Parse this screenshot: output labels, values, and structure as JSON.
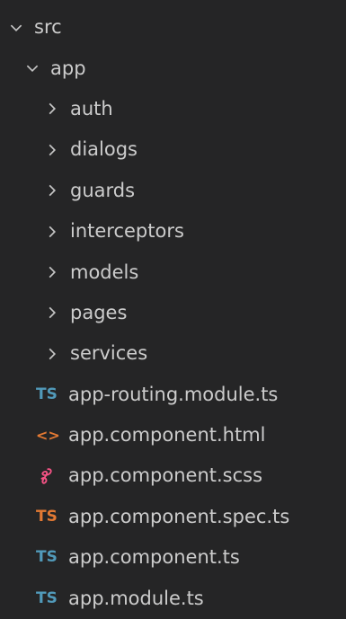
{
  "explorer": {
    "root": {
      "label": "src",
      "expanded": true,
      "icon": "chevron-down-icon"
    },
    "app": {
      "label": "app",
      "expanded": true,
      "icon": "chevron-down-icon"
    },
    "folders": [
      {
        "label": "auth",
        "icon": "chevron-right-icon"
      },
      {
        "label": "dialogs",
        "icon": "chevron-right-icon"
      },
      {
        "label": "guards",
        "icon": "chevron-right-icon"
      },
      {
        "label": "interceptors",
        "icon": "chevron-right-icon"
      },
      {
        "label": "models",
        "icon": "chevron-right-icon"
      },
      {
        "label": "pages",
        "icon": "chevron-right-icon"
      },
      {
        "label": "services",
        "icon": "chevron-right-icon"
      }
    ],
    "files": [
      {
        "label": "app-routing.module.ts",
        "icon": "typescript-icon",
        "icon_text": "TS",
        "color": "#519aba"
      },
      {
        "label": "app.component.html",
        "icon": "html-icon",
        "icon_text": "<>",
        "color": "#e37933"
      },
      {
        "label": "app.component.scss",
        "icon": "sass-icon",
        "color": "#f55385"
      },
      {
        "label": "app.component.spec.ts",
        "icon": "typescript-spec-icon",
        "icon_text": "TS",
        "color": "#e37933"
      },
      {
        "label": "app.component.ts",
        "icon": "typescript-icon",
        "icon_text": "TS",
        "color": "#519aba"
      },
      {
        "label": "app.module.ts",
        "icon": "typescript-icon",
        "icon_text": "TS",
        "color": "#519aba"
      }
    ]
  }
}
